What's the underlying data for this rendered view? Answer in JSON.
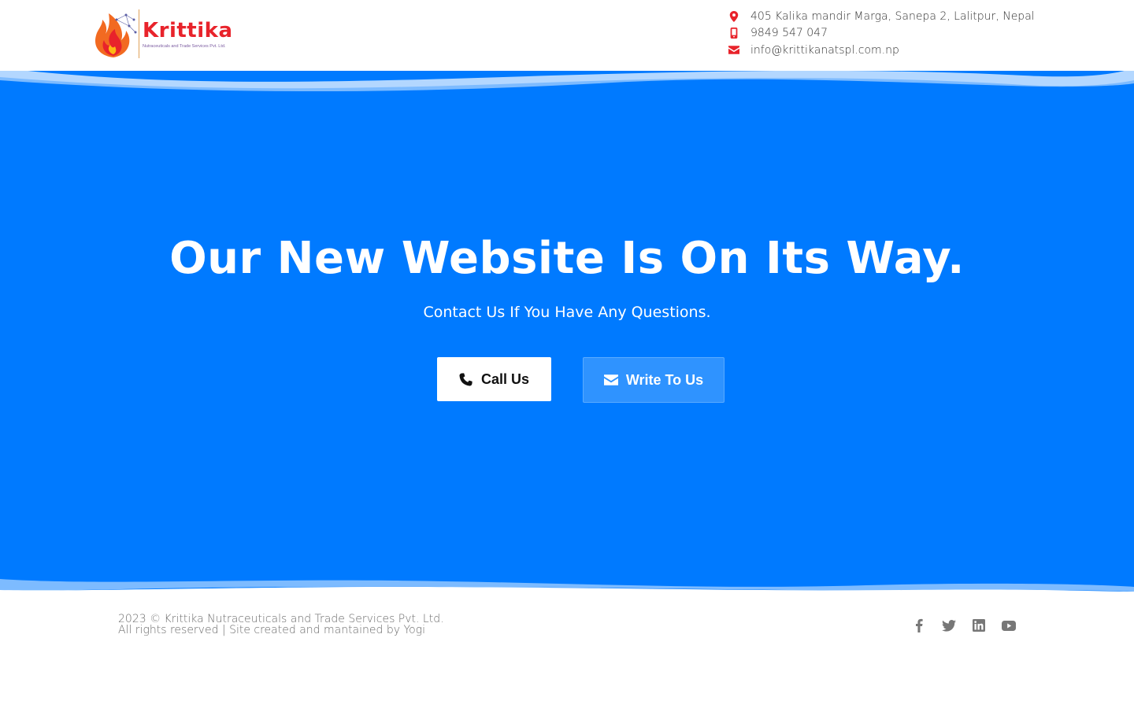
{
  "brand": {
    "name": "Krittika",
    "tagline": "Nutraceuticals and Trade Services Pvt. Ltd.",
    "color": "#e8232b"
  },
  "contact": {
    "items": [
      {
        "icon": "map-pin-icon",
        "text": "405 Kalika mandir Marga, Sanepa 2, Lalitpur, Nepal"
      },
      {
        "icon": "mobile-icon",
        "text": "9849 547 047"
      },
      {
        "icon": "envelope-icon",
        "text": "info@krittikanatspl.com.np"
      }
    ],
    "icon_color": "#e8232b"
  },
  "hero": {
    "title": "Our New Website Is On Its Way.",
    "subtitle": "Contact Us If You Have Any Questions.",
    "background": "#007aff",
    "call_label": "Call Us",
    "write_label": "Write To Us"
  },
  "footer": {
    "copyright": "2023 © Krittika Nutraceuticals and Trade Services Pvt. Ltd.",
    "rights": "All rights reserved | Site created and mantained by Yogi",
    "social": [
      "facebook-icon",
      "twitter-icon",
      "linkedin-icon",
      "youtube-icon"
    ]
  }
}
